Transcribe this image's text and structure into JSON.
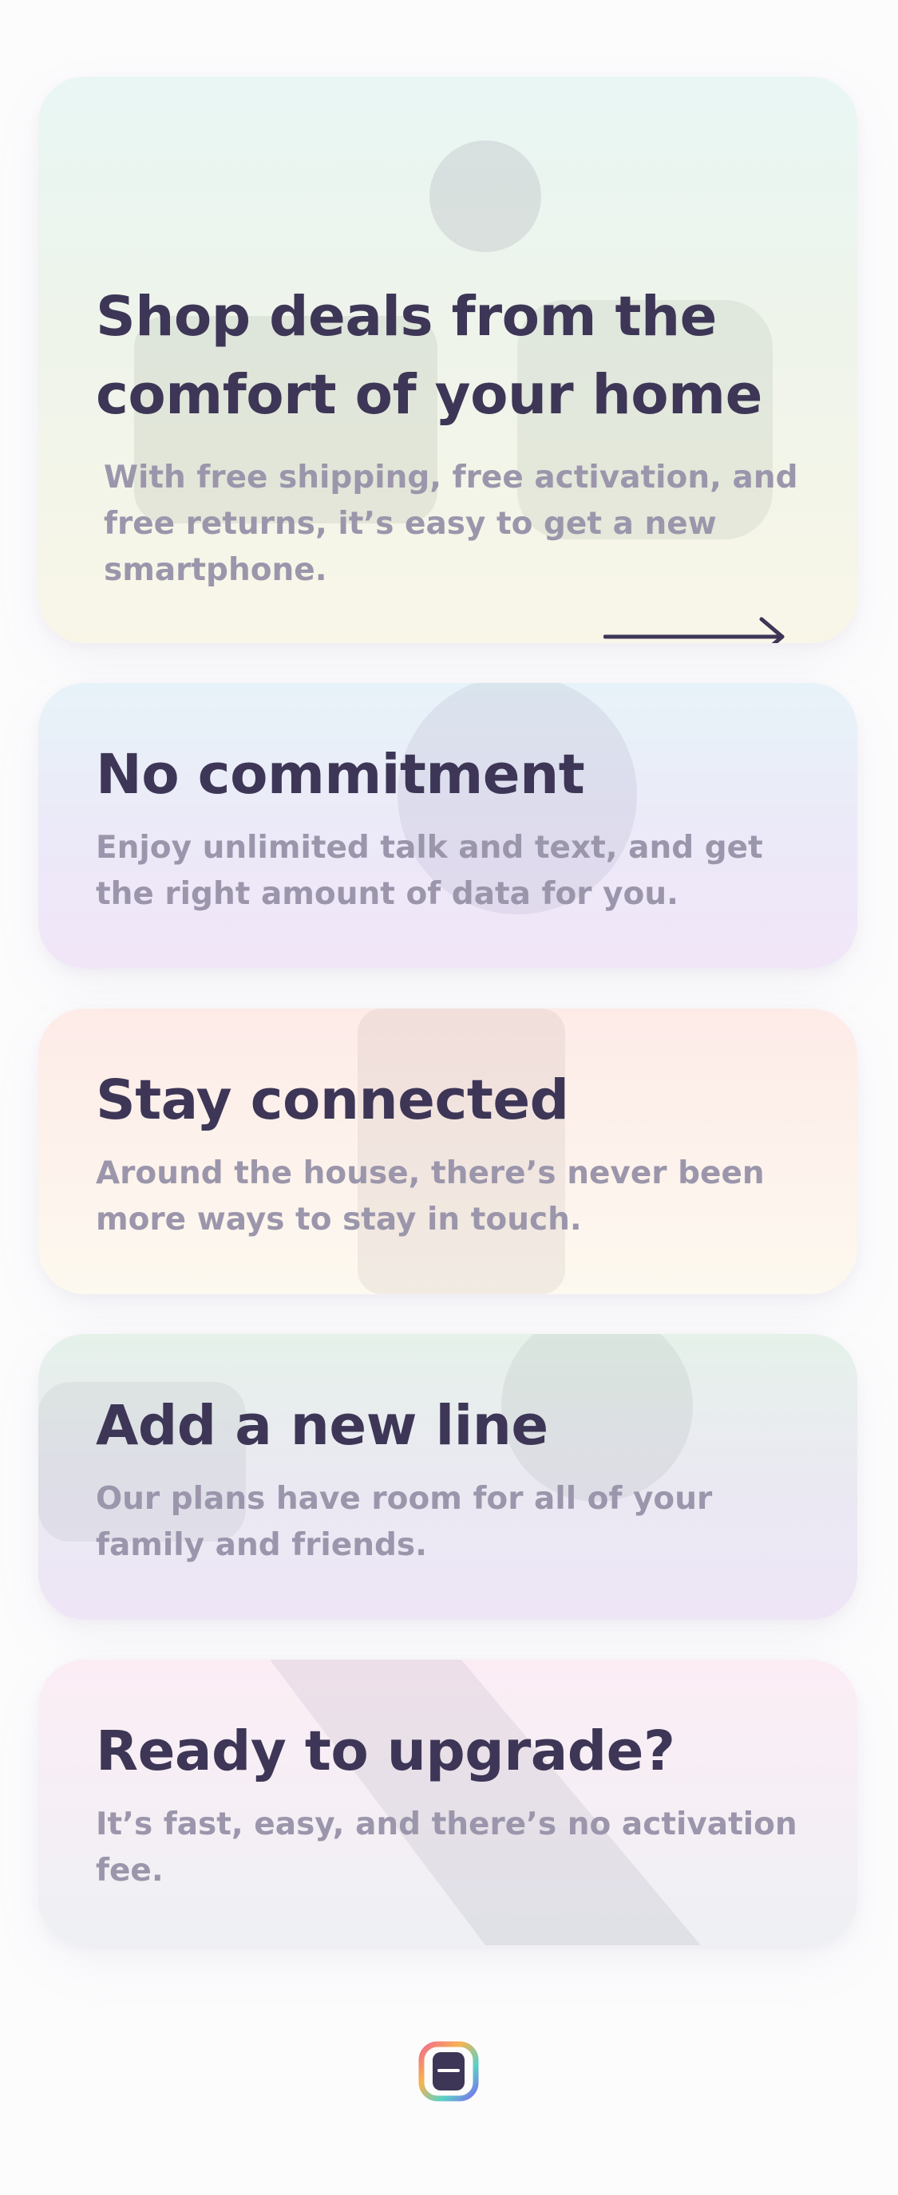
{
  "cards": [
    {
      "title": "Shop deals from the comfort of your home",
      "text": "With free shipping, free activation, and free returns, it’s easy to get a new smartphone.",
      "action_icon": "arrow-right-icon"
    },
    {
      "title": "No commitment",
      "text": "Enjoy unlimited talk and text, and get the right amount of data for you."
    },
    {
      "title": "Stay connected",
      "text": "Around the house, there’s never been more ways to stay in touch."
    },
    {
      "title": "Add a new line",
      "text": "Our plans have room for all of your family and friends."
    },
    {
      "title": "Ready to upgrade?",
      "text": "It’s fast, easy, and there’s no activation fee."
    }
  ],
  "footer": {
    "logo_icon": "app-logo-icon"
  },
  "colors": {
    "title": "#3d3656",
    "body_text": "#9b96ab",
    "page_background": "#fdfcfd"
  }
}
